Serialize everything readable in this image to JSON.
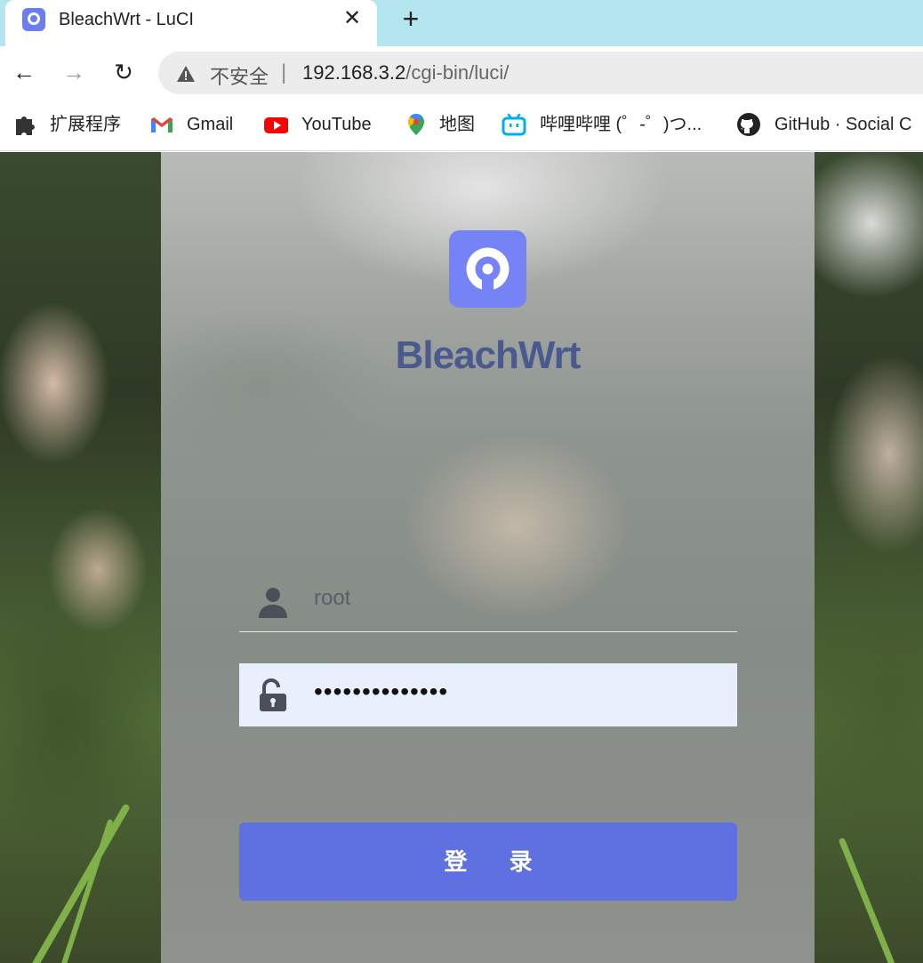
{
  "browser": {
    "tab": {
      "title": "BleachWrt - LuCI",
      "close": "✕"
    },
    "new_tab": "+",
    "nav": {
      "back": "←",
      "forward": "→",
      "reload": "↻"
    },
    "address": {
      "security_label": "不安全",
      "separator": "|",
      "host": "192.168.3.2",
      "path": "/cgi-bin/luci/"
    },
    "bookmarks": [
      {
        "label": "扩展程序",
        "icon": "puzzle-icon"
      },
      {
        "label": "Gmail",
        "icon": "gmail-icon"
      },
      {
        "label": "YouTube",
        "icon": "youtube-icon"
      },
      {
        "label": "地图",
        "icon": "maps-pin-icon"
      },
      {
        "label": "哔哩哔哩 (゜-゜)つ...",
        "icon": "bilibili-icon"
      },
      {
        "label": "GitHub · Social C",
        "icon": "github-icon"
      }
    ]
  },
  "login": {
    "brand": "BleachWrt",
    "username": "root",
    "password_mask": "••••••••••••••",
    "submit_label": "登 录"
  },
  "colors": {
    "accent": "#5f71e0",
    "logo": "#7583f6",
    "brand_text": "#4a5a8f",
    "autofill": "#e8f0fe"
  }
}
